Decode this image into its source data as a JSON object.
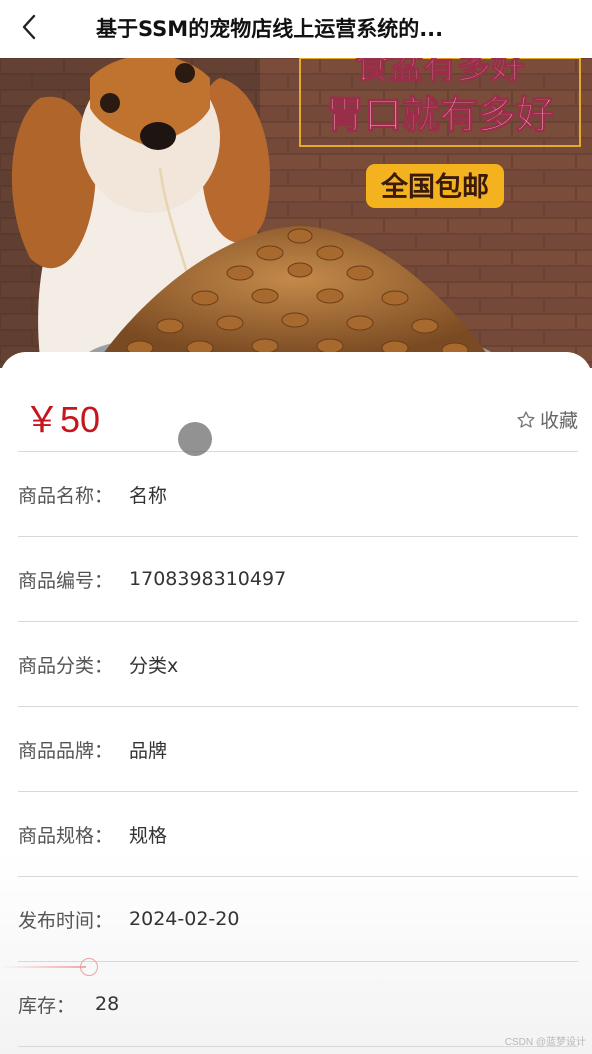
{
  "header": {
    "title": "基于SSM的宠物店线上运营系统的..."
  },
  "banner": {
    "slogan_line1": "食盆有多好",
    "slogan_line2": "胃口就有多好",
    "badge": "全国包邮"
  },
  "product": {
    "price": "￥50",
    "favorite_label": "收藏",
    "fields": [
      {
        "label": "商品名称：",
        "value": "名称"
      },
      {
        "label": "商品编号：",
        "value": "1708398310497"
      },
      {
        "label": "商品分类：",
        "value": "分类x"
      },
      {
        "label": "商品品牌：",
        "value": "品牌"
      },
      {
        "label": "商品规格：",
        "value": "规格"
      },
      {
        "label": "发布时间：",
        "value": "2024-02-20"
      },
      {
        "label": "库存：",
        "value": "28"
      }
    ]
  },
  "watermark": "CSDN @蓝梦设计",
  "colors": {
    "price": "#c4161c",
    "divider": "#d8d8d8",
    "slogan_fill": "#f2b8c8",
    "badge_bg": "#f5b21f"
  }
}
